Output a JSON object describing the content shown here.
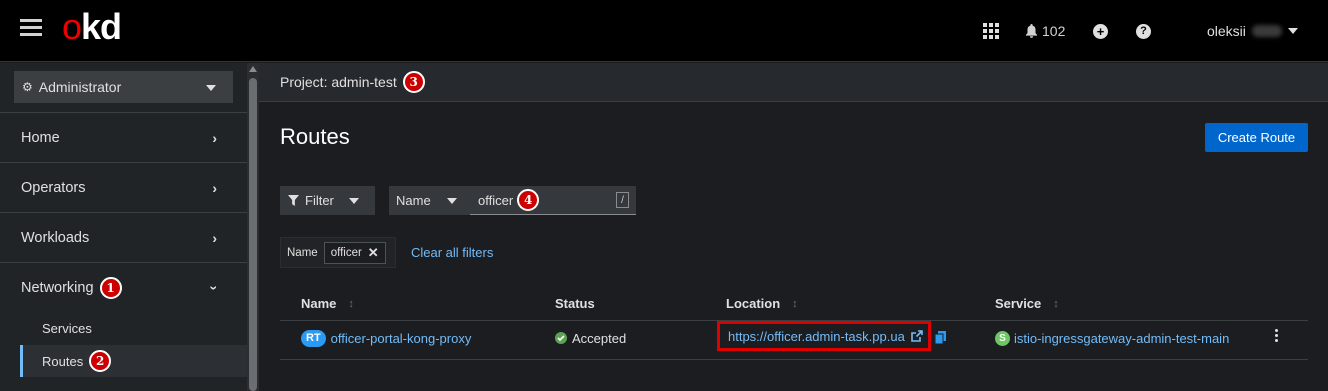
{
  "header": {
    "brand": "okd",
    "notifications_count": "102",
    "username": "oleksii"
  },
  "sidebar": {
    "perspective": "Administrator",
    "items": [
      {
        "label": "Home"
      },
      {
        "label": "Operators"
      },
      {
        "label": "Workloads"
      },
      {
        "label": "Networking",
        "badge": "1"
      }
    ],
    "subitems": [
      {
        "label": "Services"
      },
      {
        "label": "Routes",
        "badge": "2"
      }
    ]
  },
  "project": {
    "label": "Project: admin-test",
    "badge": "3"
  },
  "page": {
    "title": "Routes",
    "create_button": "Create Route"
  },
  "filter": {
    "filter_label": "Filter",
    "attribute": "Name",
    "value": "officer",
    "value_badge": "4",
    "shortcut": "/",
    "chip_category": "Name",
    "chip_value": "officer",
    "clear_all": "Clear all filters"
  },
  "table": {
    "columns": [
      "Name",
      "Status",
      "Location",
      "Service"
    ],
    "rows": [
      {
        "name_badge": "RT",
        "name": "officer-portal-kong-proxy",
        "status": "Accepted",
        "location": "https://officer.admin-task.pp.ua",
        "service_badge": "S",
        "service": "istio-ingressgateway-admin-test-main"
      }
    ]
  },
  "colors": {
    "accent": "#0066cc",
    "link": "#73bcf7",
    "annotation_red": "#cc0000",
    "status_green": "#5ba352"
  }
}
